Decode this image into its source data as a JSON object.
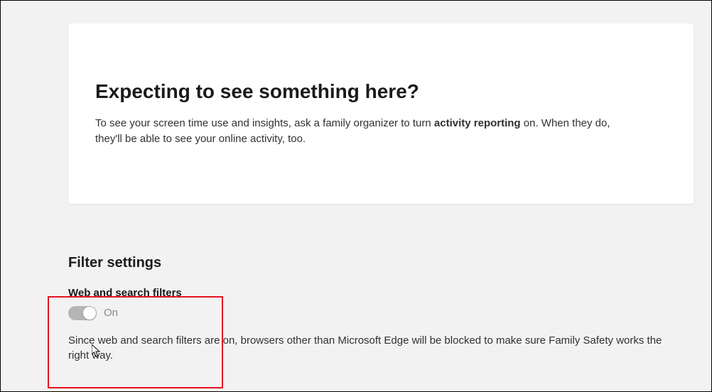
{
  "card": {
    "title": "Expecting to see something here?",
    "desc_pre": "To see your screen time use and insights, ask a family organizer to turn ",
    "desc_bold": "activity reporting",
    "desc_post": " on. When they do, they'll be able to see your online activity, too."
  },
  "filter": {
    "section_heading": "Filter settings",
    "label": "Web and search filters",
    "state": "On",
    "desc": "Since web and search filters are on, browsers other than Microsoft Edge will be blocked to make sure Family Safety works the right way."
  }
}
